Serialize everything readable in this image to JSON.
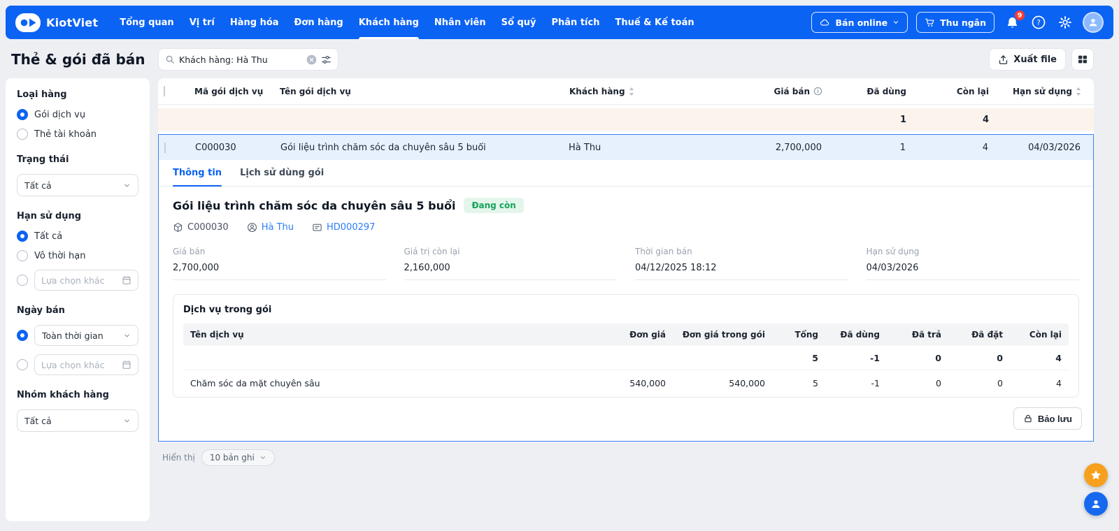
{
  "header": {
    "brand": "KiotViet",
    "nav": [
      {
        "label": "Tổng quan"
      },
      {
        "label": "Vị trí"
      },
      {
        "label": "Hàng hóa"
      },
      {
        "label": "Đơn hàng"
      },
      {
        "label": "Khách hàng"
      },
      {
        "label": "Nhân viên"
      },
      {
        "label": "Sổ quỹ"
      },
      {
        "label": "Phân tích"
      },
      {
        "label": "Thuế & Kế toán"
      }
    ],
    "actions": {
      "ban_online": "Bán online",
      "thu_ngan": "Thu ngân",
      "notification_count": "9"
    }
  },
  "page": {
    "title": "Thẻ & gói đã bán",
    "search_value": "Khách hàng: Hà Thu",
    "export_label": "Xuất file"
  },
  "sidebar": {
    "loai_hang": {
      "title": "Loại hàng",
      "options": [
        "Gói dịch vụ",
        "Thẻ tài khoản"
      ]
    },
    "trang_thai": {
      "title": "Trạng thái",
      "value": "Tất cả"
    },
    "han_su_dung": {
      "title": "Hạn sử dụng",
      "options": [
        "Tất cả",
        "Vô thời hạn"
      ],
      "custom_placeholder": "Lựa chọn khác"
    },
    "ngay_ban": {
      "title": "Ngày bán",
      "value": "Toàn thời gian",
      "custom_placeholder": "Lựa chọn khác"
    },
    "nhom_khach_hang": {
      "title": "Nhóm khách hàng",
      "value": "Tất cả"
    }
  },
  "table": {
    "headers": [
      "Mã gói dịch vụ",
      "Tên gói dịch vụ",
      "Khách hàng",
      "Giá bán",
      "Đã dùng",
      "Còn lại",
      "Hạn sử dụng"
    ],
    "summary": {
      "used": "1",
      "remaining": "4"
    },
    "row": {
      "code": "C000030",
      "name": "Gói liệu trình chăm sóc da chuyên sâu 5 buổi",
      "customer": "Hà Thu",
      "price": "2,700,000",
      "used": "1",
      "remaining": "4",
      "expiry": "04/03/2026"
    }
  },
  "detail": {
    "tabs": [
      "Thông tin",
      "Lịch sử dùng gói"
    ],
    "title": "Gói liệu trình chăm sóc da chuyên sâu 5 buổi",
    "status": "Đang còn",
    "refs": {
      "code": "C000030",
      "customer": "Hà Thu",
      "invoice": "HD000297"
    },
    "fields": [
      {
        "label": "Giá bán",
        "value": "2,700,000"
      },
      {
        "label": "Giá trị còn lại",
        "value": "2,160,000"
      },
      {
        "label": "Thời gian bán",
        "value": "04/12/2025 18:12"
      },
      {
        "label": "Hạn sử dụng",
        "value": "04/03/2026"
      }
    ],
    "services": {
      "title": "Dịch vụ trong gói",
      "headers": [
        "Tên dịch vụ",
        "Đơn giá",
        "Đơn giá trong gói",
        "Tổng",
        "Đã dùng",
        "Đã trả",
        "Đã đặt",
        "Còn lại"
      ],
      "summary": {
        "total": "5",
        "used": "-1",
        "returned": "0",
        "booked": "0",
        "remaining": "4"
      },
      "rows": [
        {
          "name": "Chăm sóc da mặt chuyên sâu",
          "unit_price": "540,000",
          "package_price": "540,000",
          "total": "5",
          "used": "-1",
          "returned": "0",
          "booked": "0",
          "remaining": "4"
        }
      ]
    },
    "bao_luu_label": "Bảo lưu"
  },
  "footer": {
    "hien_thi": "Hiển thị",
    "page_size": "10 bản ghi"
  }
}
